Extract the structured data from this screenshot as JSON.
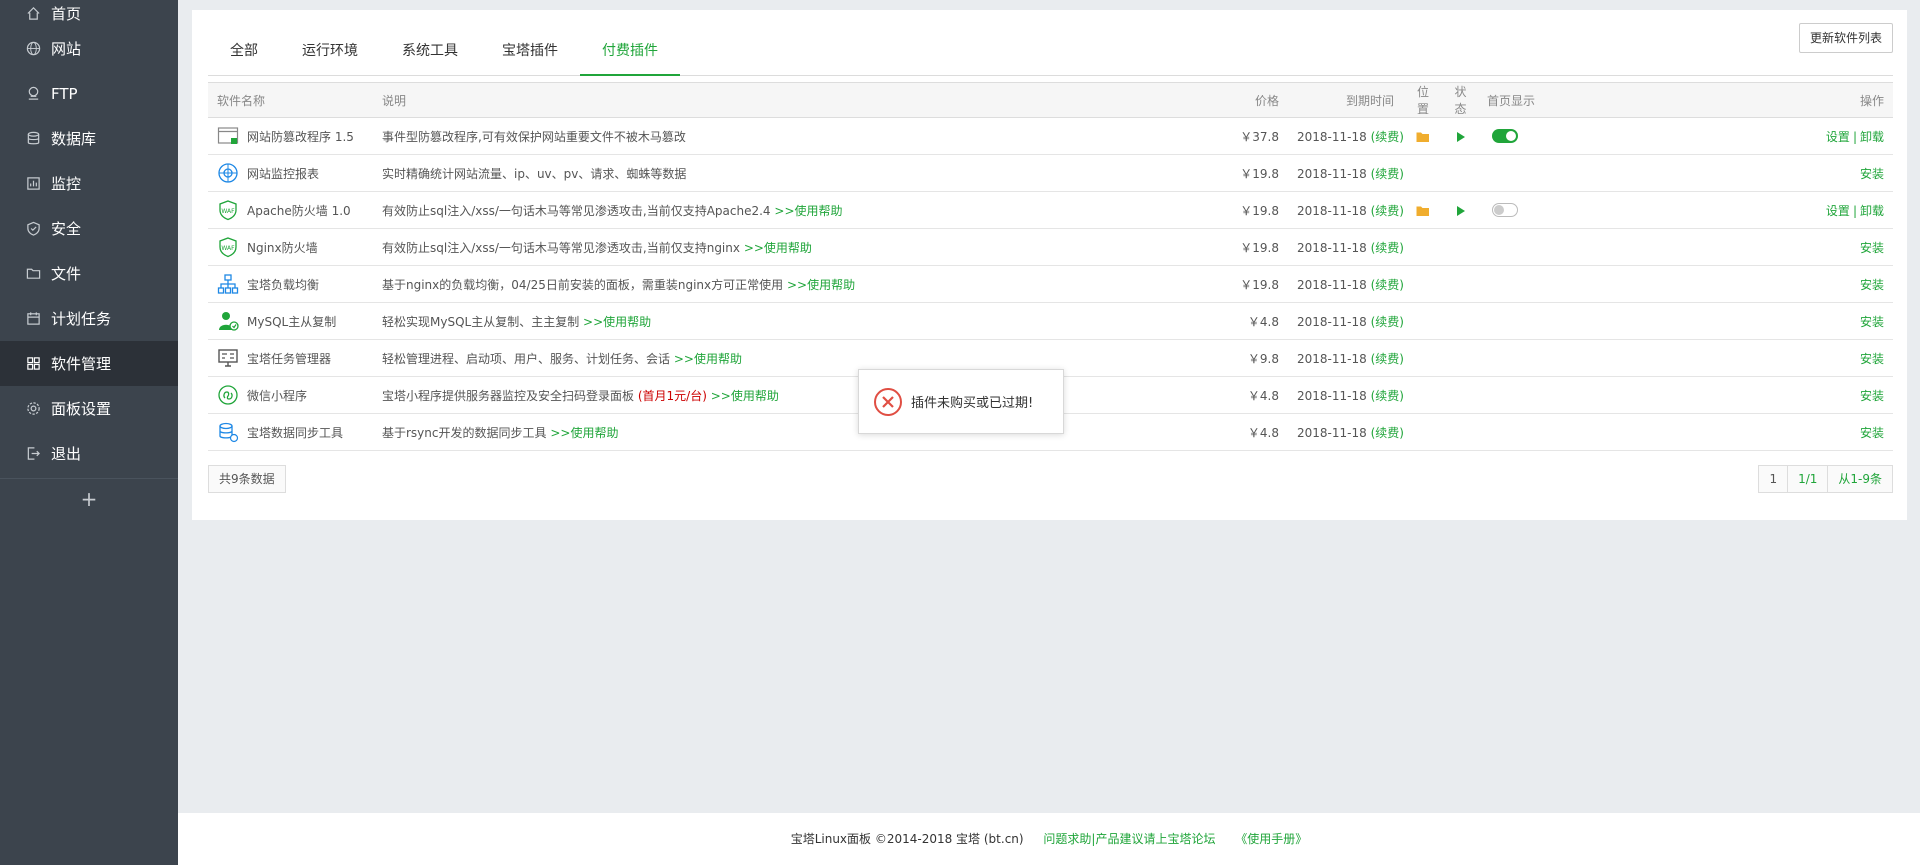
{
  "sidebar": {
    "items": [
      {
        "label": "首页",
        "icon": "home-icon"
      },
      {
        "label": "网站",
        "icon": "globe-icon"
      },
      {
        "label": "FTP",
        "icon": "ftp-icon"
      },
      {
        "label": "数据库",
        "icon": "database-icon"
      },
      {
        "label": "监控",
        "icon": "monitor-icon"
      },
      {
        "label": "安全",
        "icon": "shield-icon"
      },
      {
        "label": "文件",
        "icon": "folder-icon"
      },
      {
        "label": "计划任务",
        "icon": "calendar-icon"
      },
      {
        "label": "软件管理",
        "icon": "grid-icon",
        "active": true
      },
      {
        "label": "面板设置",
        "icon": "gear-icon"
      },
      {
        "label": "退出",
        "icon": "logout-icon"
      }
    ],
    "add_label": "+"
  },
  "tabs": [
    "全部",
    "运行环境",
    "系统工具",
    "宝塔插件",
    "付费插件"
  ],
  "active_tab": 4,
  "update_button": "更新软件列表",
  "table": {
    "headers": {
      "name": "软件名称",
      "desc": "说明",
      "price": "价格",
      "expire": "到期时间",
      "location": "位置",
      "status": "状态",
      "home": "首页显示",
      "op": "操作"
    },
    "rows": [
      {
        "name": "网站防篡改程序 1.5",
        "desc": "事件型防篡改程序,可有效保护网站重要文件不被木马篡改",
        "help": "",
        "price": "￥37.8",
        "expire": "2018-11-18",
        "renew": "(续费)",
        "folder": true,
        "play": true,
        "toggle": "on",
        "op1": "设置",
        "op2": "卸载",
        "icon": "tamper-icon"
      },
      {
        "name": "网站监控报表",
        "desc": "实时精确统计网站流量、ip、uv、pv、请求、蜘蛛等数据",
        "help": "",
        "price": "￥19.8",
        "expire": "2018-11-18",
        "renew": "(续费)",
        "folder": false,
        "play": false,
        "toggle": "",
        "op1": "",
        "op2": "安装",
        "icon": "report-icon"
      },
      {
        "name": "Apache防火墙 1.0",
        "desc": "有效防止sql注入/xss/一句话木马等常见渗透攻击,当前仅支持Apache2.4",
        "help": ">>使用帮助",
        "price": "￥19.8",
        "expire": "2018-11-18",
        "renew": "(续费)",
        "folder": true,
        "play": true,
        "toggle": "off",
        "op1": "设置",
        "op2": "卸载",
        "icon": "waf-icon"
      },
      {
        "name": "Nginx防火墙",
        "desc": "有效防止sql注入/xss/一句话木马等常见渗透攻击,当前仅支持nginx",
        "help": ">>使用帮助",
        "price": "￥19.8",
        "expire": "2018-11-18",
        "renew": "(续费)",
        "folder": false,
        "play": false,
        "toggle": "",
        "op1": "",
        "op2": "安装",
        "icon": "waf-icon"
      },
      {
        "name": "宝塔负载均衡",
        "desc": "基于nginx的负载均衡，04/25日前安装的面板，需重装nginx方可正常使用",
        "help": ">>使用帮助",
        "price": "￥19.8",
        "expire": "2018-11-18",
        "renew": "(续费)",
        "folder": false,
        "play": false,
        "toggle": "",
        "op1": "",
        "op2": "安装",
        "icon": "balance-icon"
      },
      {
        "name": "MySQL主从复制",
        "desc": "轻松实现MySQL主从复制、主主复制",
        "help": ">>使用帮助",
        "price": "￥4.8",
        "expire": "2018-11-18",
        "renew": "(续费)",
        "folder": false,
        "play": false,
        "toggle": "",
        "op1": "",
        "op2": "安装",
        "icon": "mysql-icon"
      },
      {
        "name": "宝塔任务管理器",
        "desc": "轻松管理进程、启动项、用户、服务、计划任务、会话",
        "help": ">>使用帮助",
        "price": "￥9.8",
        "expire": "2018-11-18",
        "renew": "(续费)",
        "folder": false,
        "play": false,
        "toggle": "",
        "op1": "",
        "op2": "安装",
        "icon": "task-icon"
      },
      {
        "name": "微信小程序",
        "desc": "宝塔小程序提供服务器监控及安全扫码登录面板",
        "red": "(首月1元/台)",
        "help": ">>使用帮助",
        "price": "￥4.8",
        "expire": "2018-11-18",
        "renew": "(续费)",
        "folder": false,
        "play": false,
        "toggle": "",
        "op1": "",
        "op2": "安装",
        "icon": "wechat-icon"
      },
      {
        "name": "宝塔数据同步工具",
        "desc": "基于rsync开发的数据同步工具",
        "help": ">>使用帮助",
        "price": "￥4.8",
        "expire": "2018-11-18",
        "renew": "(续费)",
        "folder": false,
        "play": false,
        "toggle": "",
        "op1": "",
        "op2": "安装",
        "icon": "sync-icon"
      }
    ]
  },
  "total_text": "共9条数据",
  "pager": {
    "current": "1",
    "pages": "1/1",
    "range": "从1-9条"
  },
  "toast": {
    "message": "插件未购买或已过期!",
    "icon": "error-icon"
  },
  "footer": {
    "copyright": "宝塔Linux面板 ©2014-2018 宝塔 (bt.cn)",
    "forum_link": "问题求助|产品建议请上宝塔论坛",
    "manual_link": "《使用手册》"
  },
  "colors": {
    "accent": "#20a53a",
    "price": "#ff7300",
    "sidebar": "#3c444d",
    "error": "#e04e43"
  }
}
